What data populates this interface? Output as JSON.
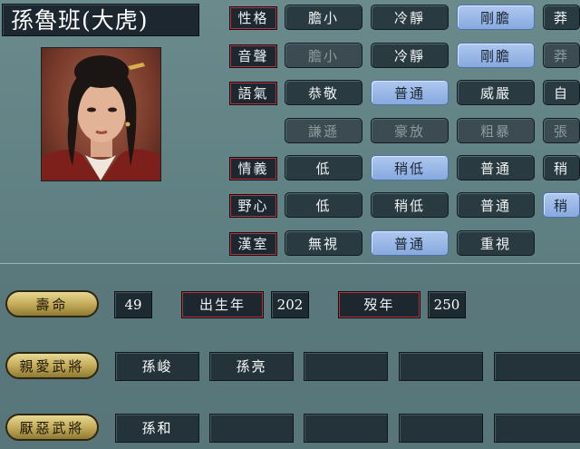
{
  "officer_name": "孫魯班(大虎)",
  "traits": [
    {
      "label": "性格",
      "options": [
        {
          "text": "膽小",
          "state": "normal"
        },
        {
          "text": "冷靜",
          "state": "normal"
        },
        {
          "text": "剛膽",
          "state": "selected"
        },
        {
          "text": "莽",
          "state": "normal"
        }
      ]
    },
    {
      "label": "音聲",
      "options": [
        {
          "text": "膽小",
          "state": "disabled"
        },
        {
          "text": "冷靜",
          "state": "normal"
        },
        {
          "text": "剛膽",
          "state": "selected"
        },
        {
          "text": "莽",
          "state": "disabled"
        }
      ]
    },
    {
      "label": "語氣",
      "options": [
        {
          "text": "恭敬",
          "state": "normal"
        },
        {
          "text": "普通",
          "state": "selected"
        },
        {
          "text": "威嚴",
          "state": "normal"
        },
        {
          "text": "自",
          "state": "normal"
        }
      ]
    },
    {
      "label": "",
      "options": [
        {
          "text": "謙遜",
          "state": "disabled"
        },
        {
          "text": "豪放",
          "state": "disabled"
        },
        {
          "text": "粗暴",
          "state": "disabled"
        },
        {
          "text": "張",
          "state": "disabled"
        }
      ]
    },
    {
      "label": "情義",
      "options": [
        {
          "text": "低",
          "state": "normal"
        },
        {
          "text": "稍低",
          "state": "selected"
        },
        {
          "text": "普通",
          "state": "normal"
        },
        {
          "text": "稍",
          "state": "normal"
        }
      ]
    },
    {
      "label": "野心",
      "options": [
        {
          "text": "低",
          "state": "normal"
        },
        {
          "text": "稍低",
          "state": "normal"
        },
        {
          "text": "普通",
          "state": "normal"
        },
        {
          "text": "稍",
          "state": "selected"
        }
      ]
    },
    {
      "label": "漢室",
      "options": [
        {
          "text": "無視",
          "state": "normal"
        },
        {
          "text": "普通",
          "state": "selected"
        },
        {
          "text": "重視",
          "state": "normal"
        }
      ]
    }
  ],
  "lifespan": {
    "button": "壽命",
    "value": "49",
    "birth_label": "出生年",
    "birth_value": "202",
    "death_label": "歿年",
    "death_value": "250"
  },
  "liked": {
    "button": "親愛武將",
    "slots": [
      "孫峻",
      "孫亮",
      "",
      "",
      ""
    ]
  },
  "disliked": {
    "button": "厭惡武將",
    "slots": [
      "孫和",
      "",
      "",
      "",
      ""
    ]
  }
}
